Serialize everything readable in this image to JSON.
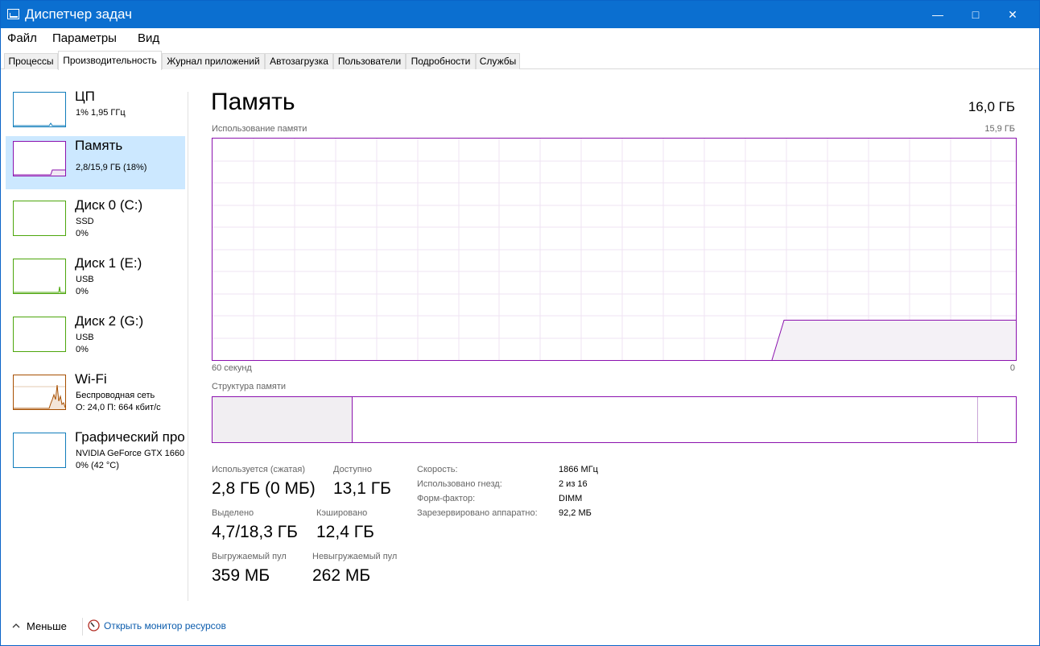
{
  "window": {
    "title": "Диспетчер задач",
    "minimize": "—",
    "maximize": "□",
    "close": "✕"
  },
  "menu": [
    "Файл",
    "Параметры",
    "Вид"
  ],
  "tabs": [
    "Процессы",
    "Производительность",
    "Журнал приложений",
    "Автозагрузка",
    "Пользователи",
    "Подробности",
    "Службы"
  ],
  "sidebar": [
    {
      "title": "ЦП",
      "lines": [
        "1%  1,95 ГГц"
      ],
      "color": "#117dbb"
    },
    {
      "title": "Память",
      "lines": [
        "2,8/15,9 ГБ (18%)"
      ],
      "color": "#8b12ae"
    },
    {
      "title": "Диск 0 (C:)",
      "lines": [
        "SSD",
        "0%"
      ],
      "color": "#4da60c"
    },
    {
      "title": "Диск 1 (E:)",
      "lines": [
        "USB",
        "0%"
      ],
      "color": "#4da60c"
    },
    {
      "title": "Диск 2 (G:)",
      "lines": [
        "USB",
        "0%"
      ],
      "color": "#4da60c"
    },
    {
      "title": "Wi-Fi",
      "lines": [
        "Беспроводная сеть",
        "О: 24,0  П: 664 кбит/с"
      ],
      "color": "#a74f01"
    },
    {
      "title": "Графический про",
      "lines": [
        "NVIDIA GeForce GTX 1660",
        "0%  (42 °C)"
      ],
      "color": "#117dbb"
    }
  ],
  "main": {
    "title": "Память",
    "total": "16,0 ГБ",
    "graph_label": "Использование памяти",
    "graph_max": "15,9 ГБ",
    "graph_left": "60 секунд",
    "graph_right": "0",
    "struct_label": "Структура памяти",
    "usage_fraction": 0.18
  },
  "stats": {
    "used_label": "Используется (сжатая)",
    "used_value": "2,8 ГБ (0 МБ)",
    "avail_label": "Доступно",
    "avail_value": "13,1 ГБ",
    "committed_label": "Выделено",
    "committed_value": "4,7/18,3 ГБ",
    "cached_label": "Кэшировано",
    "cached_value": "12,4 ГБ",
    "paged_label": "Выгружаемый пул",
    "paged_value": "359 МБ",
    "nonpaged_label": "Невыгружаемый пул",
    "nonpaged_value": "262 МБ"
  },
  "details": [
    {
      "key": "Скорость:",
      "value": "1866 МГц"
    },
    {
      "key": "Использовано гнезд:",
      "value": "2 из 16"
    },
    {
      "key": "Форм-фактор:",
      "value": "DIMM"
    },
    {
      "key": "Зарезервировано аппаратно:",
      "value": "92,2 МБ"
    }
  ],
  "footer": {
    "less": "Меньше",
    "monitor": "Открыть монитор ресурсов"
  }
}
